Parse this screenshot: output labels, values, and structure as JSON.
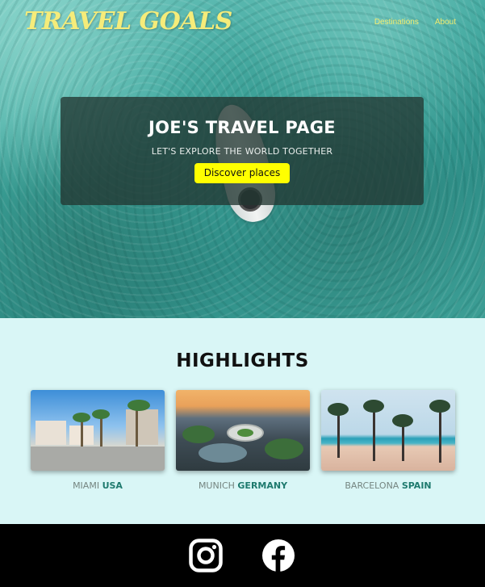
{
  "header": {
    "logo": "TRAVEL GOALS",
    "nav": [
      {
        "label": "Destinations"
      },
      {
        "label": "About"
      }
    ]
  },
  "hero": {
    "title": "JOE'S TRAVEL PAGE",
    "subtitle": "LET'S EXPLORE THE WORLD TOGETHER",
    "button_label": "Discover places"
  },
  "highlights": {
    "title": "HIGHLIGHTS",
    "cards": [
      {
        "city": "MIAMI",
        "country": "USA"
      },
      {
        "city": "MUNICH",
        "country": "GERMANY"
      },
      {
        "city": "BARCELONA",
        "country": "SPAIN"
      }
    ]
  },
  "footer": {
    "icons": [
      "instagram-icon",
      "facebook-icon"
    ]
  },
  "colors": {
    "accent_yellow": "#ffff00",
    "logo_yellow": "#f5ec7a",
    "highlights_bg": "#d9f6f6",
    "country_green": "#1e7a6e",
    "footer_bg": "#000000"
  }
}
